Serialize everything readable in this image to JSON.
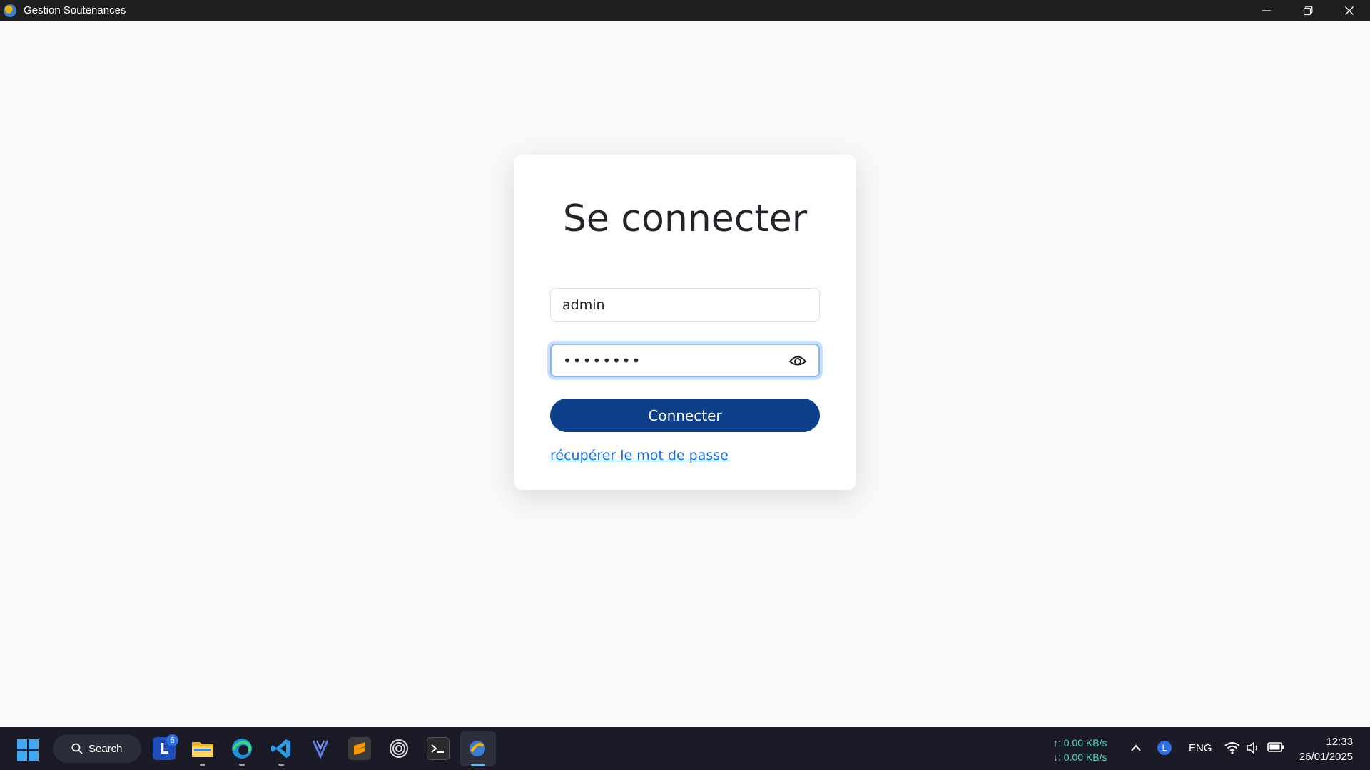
{
  "window": {
    "title": "Gestion Soutenances"
  },
  "login": {
    "title": "Se connecter",
    "username_value": "admin",
    "password_value": "••••••••",
    "connect_label": "Connecter",
    "recover_label": "récupérer le mot de passe"
  },
  "taskbar": {
    "search_label": "Search",
    "badge_count": "6",
    "apps": [
      "lockdown-l-icon",
      "file-explorer-icon",
      "edge-icon",
      "vscode-icon",
      "plugin-icon",
      "sublime-text-icon",
      "circle-app-icon",
      "terminal-icon",
      "gestion-app-icon"
    ],
    "net_up": "↑: 0.00 KB/s",
    "net_down": "↓: 0.00 KB/s",
    "tray_l": "L",
    "language": "ENG",
    "time": "12:33",
    "date": "26/01/2025"
  },
  "colors": {
    "primary_button": "#0d3f8a",
    "link": "#0d6efd",
    "focus_border": "#86b7fe",
    "taskbar_bg": "#1a1b26",
    "titlebar_bg": "#1f1f1f"
  }
}
